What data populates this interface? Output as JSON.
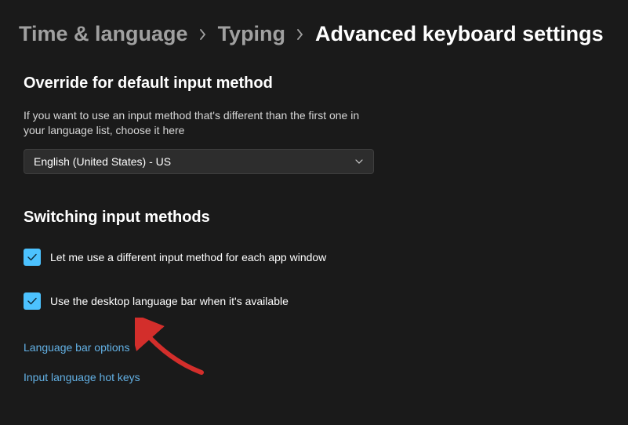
{
  "breadcrumb": {
    "item1": "Time & language",
    "item2": "Typing",
    "current": "Advanced keyboard settings"
  },
  "override": {
    "title": "Override for default input method",
    "description": "If you want to use an input method that's different than the first one in your language list, choose it here",
    "dropdown_value": "English (United States) - US"
  },
  "switching": {
    "title": "Switching input methods",
    "checkbox1_label": "Let me use a different input method for each app window",
    "checkbox2_label": "Use the desktop language bar when it's available"
  },
  "links": {
    "language_bar": "Language bar options",
    "hotkeys": "Input language hot keys"
  },
  "colors": {
    "accent": "#4cc2ff",
    "link": "#63b1e5",
    "arrow": "#d32e2b"
  }
}
